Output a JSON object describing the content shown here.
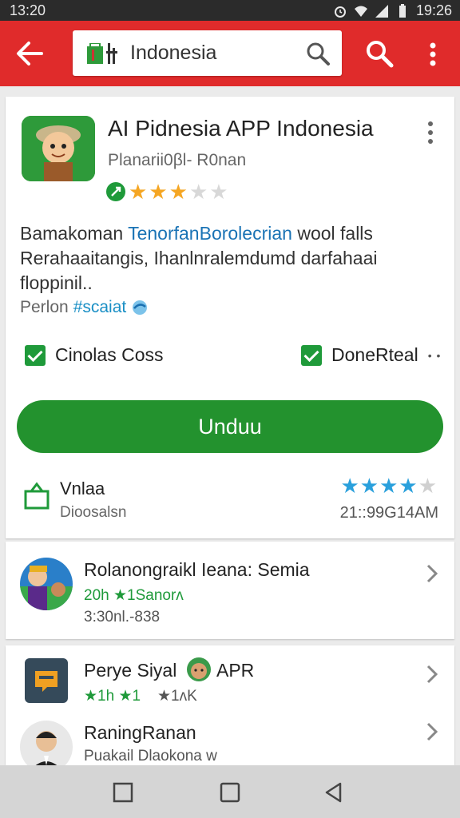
{
  "status_bar": {
    "time_left": "13:20",
    "time_right": "19:26"
  },
  "search": {
    "query": "Indonesia"
  },
  "app": {
    "title": "AI Pidnesia APP Indonesia",
    "developer": "Planarii0βl- R0nan",
    "rating_stars": 3,
    "rating_max": 5,
    "description_part1": "Bamakoman ",
    "description_link": "TenorfanBorolecrian",
    "description_part2": " wool falls Rerahaaitangis, Ihanlnralemdumd darfahaai floppinil..",
    "tagline_prefix": "Perlon ",
    "tagline_hashtag": "#scaiat",
    "checks": [
      {
        "label": "Cinolas Coss",
        "checked": true
      },
      {
        "label": "DoneRteal",
        "checked": true
      }
    ],
    "install_label": "Unduu",
    "size_label": "Vnlaa",
    "size_sub": "Dioosalsn",
    "review_stars": 4,
    "review_max": 5,
    "date_text": "21::99G14AM"
  },
  "related": [
    {
      "title": "Rolanongraikl Ieana: Semia",
      "green": "20h ★1Sanorʌ",
      "gray": "3:30nl.-838"
    },
    {
      "title": "Perye Siyal",
      "title_suffix": "APR",
      "green": "★1h ★1",
      "gray": "★1ʌK"
    },
    {
      "title": "RaningRanan",
      "gray": "Puakail  Dlaokona w"
    }
  ],
  "colors": {
    "app_bar": "#e02b2b",
    "install": "#23922e",
    "star": "#f5a623",
    "star_blue": "#2aa0dc"
  }
}
